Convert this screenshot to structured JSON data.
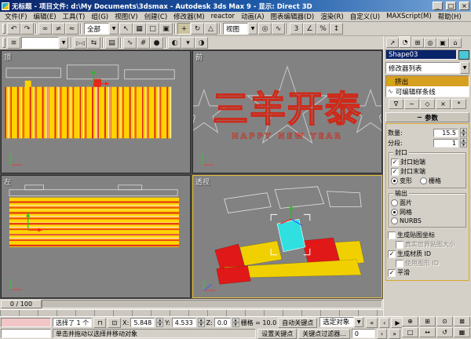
{
  "window": {
    "title": "无标题 - 项目文件:  d:\\My Documents\\3dsmax - Autodesk 3ds Max 9 -  显示: Direct 3D",
    "minimize": "_",
    "maximize": "□",
    "close": "×"
  },
  "menu": {
    "items": [
      "文件(F)",
      "编辑(E)",
      "工具(T)",
      "组(G)",
      "视图(V)",
      "创建(C)",
      "修改器(M)",
      "reactor",
      "动画(A)",
      "图表编辑器(D)",
      "渲染(R)",
      "自定义(U)",
      "MAXScript(M)",
      "帮助(H)"
    ]
  },
  "toolbar": {
    "filter_dropdown": "全部",
    "coord_dropdown": "视图"
  },
  "viewports": {
    "top": {
      "label": "顶"
    },
    "front": {
      "label": "前",
      "banner": "三羊开泰",
      "subbanner": "HAPPY NEW YEAR"
    },
    "left": {
      "label": "左"
    },
    "persp": {
      "label": "透视"
    }
  },
  "timeline": {
    "slider_label": "0 / 100"
  },
  "command_panel": {
    "object_name": "Shape03",
    "modifier_list": "修改器列表",
    "stack_modifier": "挤出",
    "stack_base": "可编辑样条线",
    "rollout": "参数",
    "amount_label": "数量:",
    "amount": "15.5",
    "segments_label": "分段:",
    "segments": "1",
    "cap_group": "封口",
    "cap_start": "封口始端",
    "cap_end": "封口末端",
    "morph": "变形",
    "grid": "栅格",
    "output_group": "输出",
    "patch": "面片",
    "mesh": "网格",
    "nurbs": "NURBS",
    "gen_map": "生成贴图坐标",
    "real_world": "真实世界贴图大小",
    "gen_mat": "生成材质 ID",
    "use_shape": "使用图形 ID",
    "smooth": "平滑"
  },
  "status": {
    "selection": "选择了 1 个",
    "x_label": "X:",
    "x": "5.848",
    "y_label": "Y:",
    "y": "4.533",
    "z_label": "Z:",
    "z": "0.0",
    "grid": "栅格 = 10.0",
    "prompt": "单击并拖动以选择并移动对象",
    "auto_key": "自动关键点",
    "set_key": "设置关键点",
    "selected": "选定对象",
    "key_filters": "关键点过滤器...",
    "frame": "0"
  },
  "icons": {
    "dropdown_arrow": "▼",
    "undo": "↶",
    "redo": "↷",
    "link": "∞",
    "unlink": "≠",
    "bind_spacewarp": "≈",
    "select": "↖",
    "select_by_name": "▦",
    "region": "□",
    "window_crossing": "▣",
    "move": "+",
    "rotate": "↻",
    "scale": "△",
    "pivot_center": "◎",
    "manipulate": "∿",
    "snap_3d": "3",
    "snap_angle": "∠",
    "snap_percent": "%",
    "snap_spinner": "↕",
    "edit_named_sets": "≡",
    "mirror": "▷◁",
    "align": "⇆",
    "layers": "▤",
    "curve_editor": "∿",
    "schematic_view": "#",
    "material_editor": "●",
    "render_scene": "◐",
    "render_type": "▾",
    "quick_render": "◑",
    "create_tab": "↗",
    "modify_tab": "◔",
    "hierarchy_tab": "⊞",
    "motion_tab": "◎",
    "display_tab": "▣",
    "utilities_tab": "⌂",
    "pin_stack": "∇",
    "show_end_result": "~",
    "make_unique": "◇",
    "remove_modifier": "×",
    "configure_sets": "*",
    "bulb": "●",
    "spline": "∿",
    "collapse": "−",
    "check": "✓",
    "spin_up": "▲",
    "spin_down": "▼",
    "lock": "⊓",
    "absolute_mode": "⊡",
    "go_start": "«",
    "prev": "‹",
    "play": "▶",
    "next": "›",
    "go_end": "»",
    "zoom": "⊕",
    "zoom_all": "⊞",
    "zoom_extents": "⊙",
    "zoom_extents_all": "⊠",
    "zoom_region": "□",
    "pan": "↔",
    "arc_rotate": "↺",
    "min_max_toggle": "▦"
  }
}
